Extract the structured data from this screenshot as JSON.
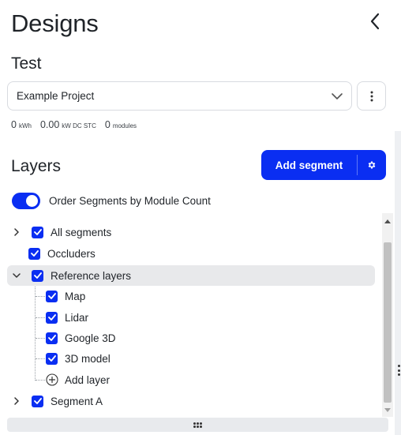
{
  "header": {
    "title": "Designs",
    "back_icon": "chevron-left-icon"
  },
  "design": {
    "name": "Test"
  },
  "project_select": {
    "value": "Example Project",
    "icon": "chevron-down-icon"
  },
  "more_menu": {
    "icon": "vertical-dots-icon"
  },
  "stats": [
    {
      "value": "0",
      "unit": "kWh"
    },
    {
      "value": "0.00",
      "unit": "kW DC STC"
    },
    {
      "value": "0",
      "unit": "modules"
    }
  ],
  "layers": {
    "title": "Layers",
    "add_segment_label": "Add segment",
    "settings_icon": "gear-icon",
    "order_toggle": {
      "label": "Order Segments by Module Count",
      "on": true
    },
    "tree": [
      {
        "label": "All segments",
        "checked": true,
        "expander": "collapsed"
      },
      {
        "label": "Occluders",
        "checked": true
      },
      {
        "label": "Reference layers",
        "checked": true,
        "expander": "expanded",
        "highlighted": true
      },
      {
        "label": "Map",
        "checked": true
      },
      {
        "label": "Lidar",
        "checked": true
      },
      {
        "label": "Google 3D",
        "checked": true
      },
      {
        "label": "3D model",
        "checked": true
      },
      {
        "label": "Add layer",
        "icon": "plus-circle-icon"
      },
      {
        "label": "Segment A",
        "checked": true,
        "expander": "collapsed"
      }
    ]
  },
  "colors": {
    "accent": "#0a2ef2",
    "highlight": "#e8e9eb",
    "text": "#1f2328"
  }
}
